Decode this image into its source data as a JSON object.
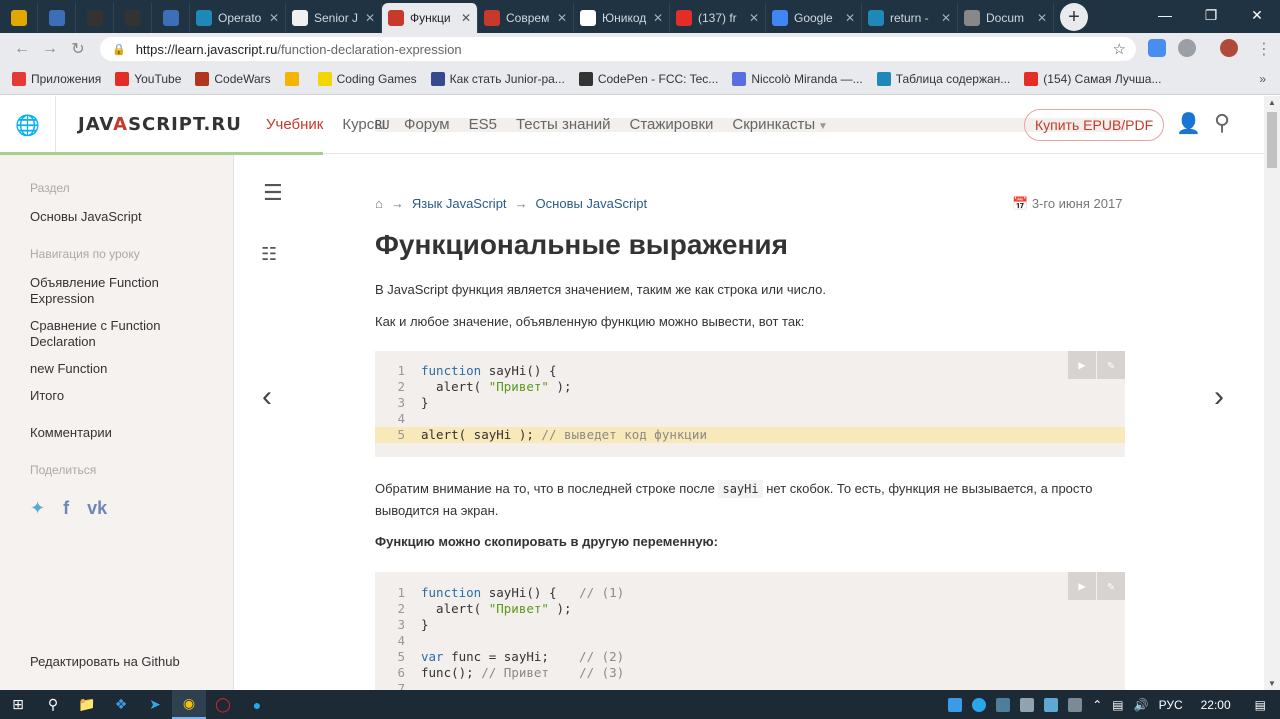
{
  "browser": {
    "tabs": [
      {
        "title": "",
        "icon": "m-icon",
        "color": "#e0a800",
        "small": true
      },
      {
        "title": "",
        "icon": "chart-icon",
        "color": "#3b6fb6",
        "small": true
      },
      {
        "title": "",
        "icon": "bars-icon",
        "color": "#333333",
        "small": true
      },
      {
        "title": "",
        "icon": "bars-icon",
        "color": "#333333",
        "small": true
      },
      {
        "title": "",
        "icon": "eye-icon",
        "color": "#3b6fb6",
        "small": true
      },
      {
        "title": "Operato",
        "icon": "hat-icon",
        "color": "#1e88b8"
      },
      {
        "title": "Senior J",
        "icon": "info-icon",
        "color": "#f0f0f0"
      },
      {
        "title": "Функци",
        "icon": "js-flame-icon",
        "color": "#c7392a",
        "active": true
      },
      {
        "title": "Соврем",
        "icon": "js-flame-icon",
        "color": "#c7392a"
      },
      {
        "title": "Юникод",
        "icon": "wikipedia-icon",
        "color": "#ffffff"
      },
      {
        "title": "(137) fr",
        "icon": "youtube-icon",
        "color": "#e52d27"
      },
      {
        "title": "Google",
        "icon": "google-translate-icon",
        "color": "#4285f4"
      },
      {
        "title": "return -",
        "icon": "hat-icon",
        "color": "#1e88b8"
      },
      {
        "title": "Docum",
        "icon": "globe-icon",
        "color": "#888888"
      }
    ],
    "url_host": "https://learn.javascript.ru",
    "url_path": "/function-declaration-expression",
    "bookmarks": [
      {
        "label": "Приложения",
        "color": "#e53935"
      },
      {
        "label": "YouTube",
        "color": "#e52d27"
      },
      {
        "label": "CodeWars",
        "color": "#b1361e"
      },
      {
        "label": "",
        "color": "#f4b400"
      },
      {
        "label": "Coding Games",
        "color": "#f2d600"
      },
      {
        "label": "Как стать Junior-ра...",
        "color": "#334a8e"
      },
      {
        "label": "CodePen - FCC: Tec...",
        "color": "#333333"
      },
      {
        "label": "Niccolò Miranda —...",
        "color": "#5b6ee1"
      },
      {
        "label": "Таблица содержан...",
        "color": "#1e88b8"
      },
      {
        "label": "(154) Самая Лучша...",
        "color": "#e52d27"
      }
    ]
  },
  "site": {
    "lang": "RU",
    "logo_left": "JAV",
    "logo_flame": "A",
    "logo_right": "SCRIPT.RU",
    "nav": [
      {
        "label": "Учебник",
        "active": true
      },
      {
        "label": "Курсы"
      },
      {
        "label": "Форум"
      },
      {
        "label": "ES5"
      },
      {
        "label": "Тесты знаний"
      },
      {
        "label": "Стажировки"
      },
      {
        "label": "Скринкасты"
      }
    ],
    "buy": "Купить EPUB/PDF"
  },
  "sidebar": {
    "section_head": "Раздел",
    "section": "Основы JavaScript",
    "nav_head": "Навигация по уроку",
    "items": [
      "Объявление Function Expression",
      "Сравнение с Function Declaration",
      "new Function",
      "Итого"
    ],
    "comments": "Комментарии",
    "share_head": "Поделиться",
    "edit": "Редактировать на Github"
  },
  "content": {
    "crumbs": [
      "Язык JavaScript",
      "Основы JavaScript"
    ],
    "date": "3-го июня 2017",
    "title": "Функциональные выражения",
    "p1": "В JavaScript функция является значением, таким же как строка или число.",
    "p2": "Как и любое значение, объявленную функцию можно вывести, вот так:",
    "p3_before": "Обратим внимание на то, что в последней строке после ",
    "p3_code": "sayHi",
    "p3_after": " нет скобок. То есть, функция не вызывается, а просто выводится на экран.",
    "p4": "Функцию можно скопировать в другую переменную:"
  },
  "code1": [
    {
      "n": "1",
      "html": "<span class='kw'>function</span> sayHi() {"
    },
    {
      "n": "2",
      "html": "  alert( <span class='str'>\"Привет\"</span> );"
    },
    {
      "n": "3",
      "html": "}"
    },
    {
      "n": "4",
      "html": ""
    },
    {
      "n": "5",
      "html": "alert( sayHi ); <span class='cmt'>// выведет код функции</span>",
      "hl": true
    }
  ],
  "code2": [
    {
      "n": "1",
      "html": "<span class='kw'>function</span> sayHi() {   <span class='cmt'>// (1)</span>"
    },
    {
      "n": "2",
      "html": "  alert( <span class='str'>\"Привет\"</span> );"
    },
    {
      "n": "3",
      "html": "}"
    },
    {
      "n": "4",
      "html": ""
    },
    {
      "n": "5",
      "html": "<span class='kw'>var</span> func = sayHi;    <span class='cmt'>// (2)</span>"
    },
    {
      "n": "6",
      "html": "func(); <span class='cmt'>// Привет</span>    <span class='cmt'>// (3)</span>"
    },
    {
      "n": "7",
      "html": ""
    }
  ],
  "taskbar": {
    "lang": "РУС",
    "time": "22:00"
  }
}
